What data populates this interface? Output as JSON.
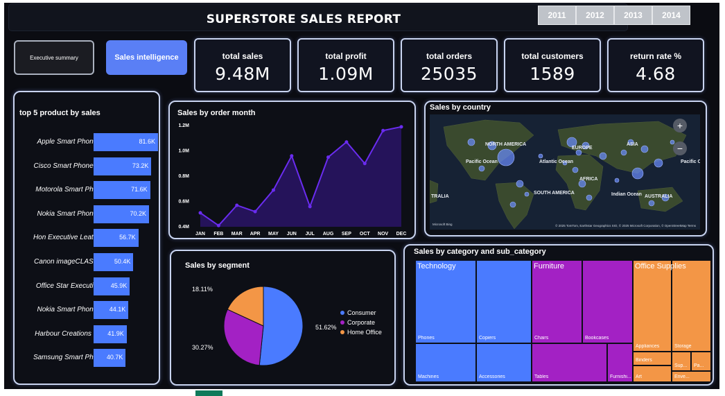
{
  "header": {
    "title": "SUPERSTORE SALES REPORT"
  },
  "years": [
    "2011",
    "2012",
    "2013",
    "2014"
  ],
  "nav": {
    "executive_label": "Executive summary",
    "sales_label": "Sales intelligence"
  },
  "kpis": [
    {
      "label": "total sales",
      "value": "9.48M"
    },
    {
      "label": "total profit",
      "value": "1.09M"
    },
    {
      "label": "total orders",
      "value": "25035"
    },
    {
      "label": "total customers",
      "value": "1589"
    },
    {
      "label": "return rate %",
      "value": "4.68"
    }
  ],
  "top_products": {
    "title": "top 5 product by sales",
    "chart_data": {
      "type": "bar",
      "categories": [
        "Apple Smart Phon...",
        "Cisco Smart Phone...",
        "Motorola Smart Ph...",
        "Nokia Smart Phon...",
        "Hon Executive Leat...",
        "Canon imageCLAS...",
        "Office Star Executi...",
        "Nokia Smart Phon...",
        "Harbour Creations ...",
        "Samsung Smart Ph..."
      ],
      "values": [
        81.6,
        73.2,
        71.6,
        70.2,
        56.7,
        50.4,
        45.9,
        44.1,
        41.9,
        40.7
      ],
      "labels": [
        "81.6K",
        "73.2K",
        "71.6K",
        "70.2K",
        "56.7K",
        "50.4K",
        "45.9K",
        "44.1K",
        "41.9K",
        "40.7K"
      ],
      "color": "#4a7bff"
    }
  },
  "monthly": {
    "title": "Sales by order month",
    "chart_data": {
      "type": "area",
      "x": [
        "JAN",
        "FEB",
        "MAR",
        "APR",
        "MAY",
        "JUN",
        "JUL",
        "AUG",
        "SEP",
        "OCT",
        "NOV",
        "DEC"
      ],
      "values": [
        0.51,
        0.41,
        0.57,
        0.52,
        0.69,
        0.96,
        0.56,
        0.95,
        1.07,
        0.9,
        1.16,
        1.19
      ],
      "ylim": [
        0.4,
        1.2
      ],
      "yticks": [
        "0.4M",
        "0.6M",
        "0.8M",
        "1.0M",
        "1.2M"
      ],
      "color": "#6a2cf0"
    }
  },
  "map": {
    "title": "Sales by country",
    "labels": [
      "NORTH AMERICA",
      "EUROPE",
      "ASIA",
      "Pacific Ocean",
      "Atlantic Ocean",
      "AFRICA",
      "Pacific Ocean",
      "SOUTH AMERICA",
      "Indian Ocean",
      "TRALIA",
      "AUSTRALIA"
    ],
    "attribution": "© 2025 TomTom, Earthstar Geographics SIO, © 2025 Microsoft Corporation, © OpenStreetMap  Terms",
    "brand": "Microsoft Bing",
    "zoom_in": "+",
    "zoom_out": "−"
  },
  "segment": {
    "title": "Sales by segment",
    "chart_data": {
      "type": "pie",
      "categories": [
        "Consumer",
        "Corporate",
        "Home Office"
      ],
      "values": [
        51.62,
        30.27,
        18.11
      ],
      "labels": [
        "51.62%",
        "30.27%",
        "18.11%"
      ],
      "colors": [
        "#4a7bff",
        "#a321c4",
        "#f39646"
      ]
    }
  },
  "treemap": {
    "title": "Sales by category and sub_category",
    "categories": [
      {
        "name": "Technology",
        "color": "#4a7bff",
        "subs": [
          "Phones",
          "Copiers",
          "Machines",
          "Accessories"
        ]
      },
      {
        "name": "Furniture",
        "color": "#a321c4",
        "subs": [
          "Chairs",
          "Bookcases",
          "Tables",
          "Furnishi..."
        ]
      },
      {
        "name": "Office Supplies",
        "color": "#f39646",
        "subs": [
          "Appliances",
          "Storage",
          "Binders",
          "Sup...",
          "Pa...",
          "Art",
          "Enve..."
        ]
      }
    ]
  }
}
